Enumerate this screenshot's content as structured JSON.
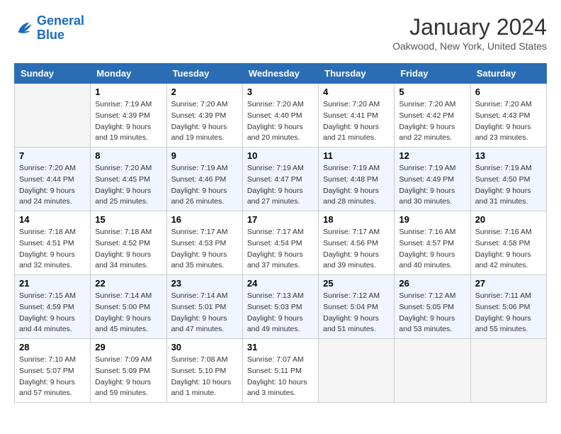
{
  "header": {
    "logo_line1": "General",
    "logo_line2": "Blue",
    "month": "January 2024",
    "location": "Oakwood, New York, United States"
  },
  "days_of_week": [
    "Sunday",
    "Monday",
    "Tuesday",
    "Wednesday",
    "Thursday",
    "Friday",
    "Saturday"
  ],
  "weeks": [
    [
      {
        "day": "",
        "info": ""
      },
      {
        "day": "1",
        "info": "Sunrise: 7:19 AM\nSunset: 4:39 PM\nDaylight: 9 hours\nand 19 minutes."
      },
      {
        "day": "2",
        "info": "Sunrise: 7:20 AM\nSunset: 4:39 PM\nDaylight: 9 hours\nand 19 minutes."
      },
      {
        "day": "3",
        "info": "Sunrise: 7:20 AM\nSunset: 4:40 PM\nDaylight: 9 hours\nand 20 minutes."
      },
      {
        "day": "4",
        "info": "Sunrise: 7:20 AM\nSunset: 4:41 PM\nDaylight: 9 hours\nand 21 minutes."
      },
      {
        "day": "5",
        "info": "Sunrise: 7:20 AM\nSunset: 4:42 PM\nDaylight: 9 hours\nand 22 minutes."
      },
      {
        "day": "6",
        "info": "Sunrise: 7:20 AM\nSunset: 4:43 PM\nDaylight: 9 hours\nand 23 minutes."
      }
    ],
    [
      {
        "day": "7",
        "info": "Sunrise: 7:20 AM\nSunset: 4:44 PM\nDaylight: 9 hours\nand 24 minutes."
      },
      {
        "day": "8",
        "info": "Sunrise: 7:20 AM\nSunset: 4:45 PM\nDaylight: 9 hours\nand 25 minutes."
      },
      {
        "day": "9",
        "info": "Sunrise: 7:19 AM\nSunset: 4:46 PM\nDaylight: 9 hours\nand 26 minutes."
      },
      {
        "day": "10",
        "info": "Sunrise: 7:19 AM\nSunset: 4:47 PM\nDaylight: 9 hours\nand 27 minutes."
      },
      {
        "day": "11",
        "info": "Sunrise: 7:19 AM\nSunset: 4:48 PM\nDaylight: 9 hours\nand 28 minutes."
      },
      {
        "day": "12",
        "info": "Sunrise: 7:19 AM\nSunset: 4:49 PM\nDaylight: 9 hours\nand 30 minutes."
      },
      {
        "day": "13",
        "info": "Sunrise: 7:19 AM\nSunset: 4:50 PM\nDaylight: 9 hours\nand 31 minutes."
      }
    ],
    [
      {
        "day": "14",
        "info": "Sunrise: 7:18 AM\nSunset: 4:51 PM\nDaylight: 9 hours\nand 32 minutes."
      },
      {
        "day": "15",
        "info": "Sunrise: 7:18 AM\nSunset: 4:52 PM\nDaylight: 9 hours\nand 34 minutes."
      },
      {
        "day": "16",
        "info": "Sunrise: 7:17 AM\nSunset: 4:53 PM\nDaylight: 9 hours\nand 35 minutes."
      },
      {
        "day": "17",
        "info": "Sunrise: 7:17 AM\nSunset: 4:54 PM\nDaylight: 9 hours\nand 37 minutes."
      },
      {
        "day": "18",
        "info": "Sunrise: 7:17 AM\nSunset: 4:56 PM\nDaylight: 9 hours\nand 39 minutes."
      },
      {
        "day": "19",
        "info": "Sunrise: 7:16 AM\nSunset: 4:57 PM\nDaylight: 9 hours\nand 40 minutes."
      },
      {
        "day": "20",
        "info": "Sunrise: 7:16 AM\nSunset: 4:58 PM\nDaylight: 9 hours\nand 42 minutes."
      }
    ],
    [
      {
        "day": "21",
        "info": "Sunrise: 7:15 AM\nSunset: 4:59 PM\nDaylight: 9 hours\nand 44 minutes."
      },
      {
        "day": "22",
        "info": "Sunrise: 7:14 AM\nSunset: 5:00 PM\nDaylight: 9 hours\nand 45 minutes."
      },
      {
        "day": "23",
        "info": "Sunrise: 7:14 AM\nSunset: 5:01 PM\nDaylight: 9 hours\nand 47 minutes."
      },
      {
        "day": "24",
        "info": "Sunrise: 7:13 AM\nSunset: 5:03 PM\nDaylight: 9 hours\nand 49 minutes."
      },
      {
        "day": "25",
        "info": "Sunrise: 7:12 AM\nSunset: 5:04 PM\nDaylight: 9 hours\nand 51 minutes."
      },
      {
        "day": "26",
        "info": "Sunrise: 7:12 AM\nSunset: 5:05 PM\nDaylight: 9 hours\nand 53 minutes."
      },
      {
        "day": "27",
        "info": "Sunrise: 7:11 AM\nSunset: 5:06 PM\nDaylight: 9 hours\nand 55 minutes."
      }
    ],
    [
      {
        "day": "28",
        "info": "Sunrise: 7:10 AM\nSunset: 5:07 PM\nDaylight: 9 hours\nand 57 minutes."
      },
      {
        "day": "29",
        "info": "Sunrise: 7:09 AM\nSunset: 5:09 PM\nDaylight: 9 hours\nand 59 minutes."
      },
      {
        "day": "30",
        "info": "Sunrise: 7:08 AM\nSunset: 5:10 PM\nDaylight: 10 hours\nand 1 minute."
      },
      {
        "day": "31",
        "info": "Sunrise: 7:07 AM\nSunset: 5:11 PM\nDaylight: 10 hours\nand 3 minutes."
      },
      {
        "day": "",
        "info": ""
      },
      {
        "day": "",
        "info": ""
      },
      {
        "day": "",
        "info": ""
      }
    ]
  ]
}
